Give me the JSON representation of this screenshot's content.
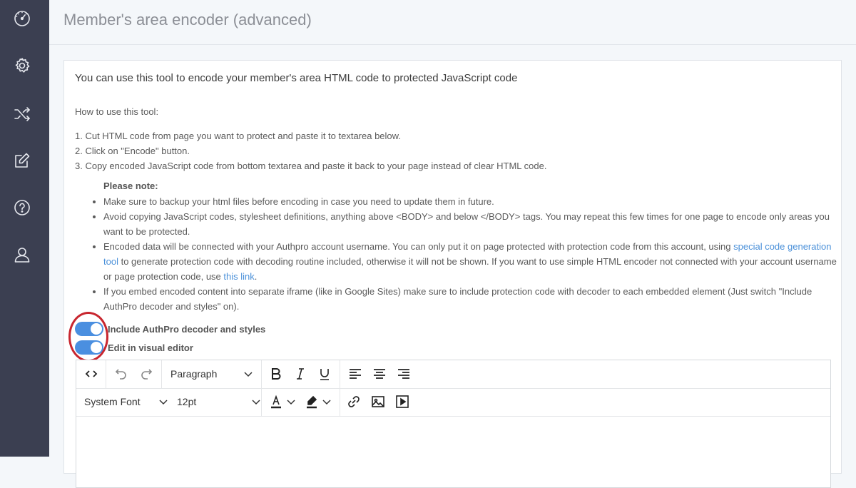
{
  "page": {
    "title": "Member's area encoder (advanced)"
  },
  "sidebar": {
    "icons": [
      "dashboard-icon",
      "gear-icon",
      "shuffle-icon",
      "edit-icon",
      "help-icon",
      "user-icon"
    ]
  },
  "content": {
    "lead": "You can use this tool to encode your member's area HTML code to protected JavaScript code",
    "howto": "How to use this tool:",
    "steps": [
      "1. Cut HTML code from page you want to protect and paste it to textarea below.",
      "2. Click on \"Encode\" button.",
      "3. Copy encoded JavaScript code from bottom textarea and paste it back to your page instead of clear HTML code."
    ],
    "note_heading": "Please note:",
    "notes": {
      "n1": "Make sure to backup your html files before encoding in case you need to update them in future.",
      "n2": "Avoid copying JavaScript codes, stylesheet definitions, anything above <BODY> and below </BODY> tags. You may repeat this few times for one page to encode only areas you want to be protected.",
      "n3_a": "Encoded data will be connected with your Authpro account username. You can only put it on page protected with protection code from this account, using ",
      "n3_link1": "special code generation tool",
      "n3_b": " to generate protection code with decoding routine included, otherwise it will not be shown. If you want to use simple HTML encoder not connected with your account username or page protection code, use ",
      "n3_link2": "this link",
      "n3_c": ".",
      "n4": "If you embed encoded content into separate iframe (like in Google Sites) make sure to include protection code with decoder to each embedded element (Just switch \"Include AuthPro decoder and styles\" on)."
    }
  },
  "toggles": {
    "include_decoder": {
      "label": "Include AuthPro decoder and styles",
      "on": true
    },
    "visual_editor": {
      "label": "Edit in visual editor",
      "on": true
    }
  },
  "editor": {
    "block_format": "Paragraph",
    "font_family": "System Font",
    "font_size": "12pt"
  },
  "colors": {
    "sidebar": "#3b3f51",
    "toggle_on": "#4a8fe0",
    "link": "#4a90d9",
    "highlight_ring": "#c8262f"
  }
}
